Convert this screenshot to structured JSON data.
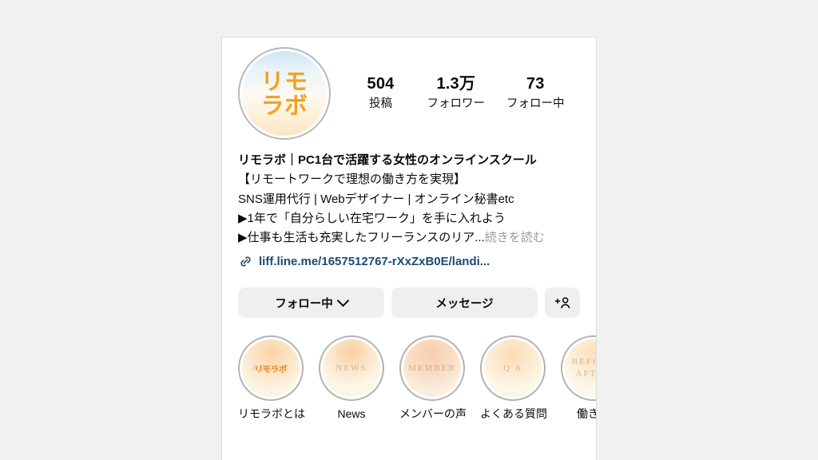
{
  "page": {
    "background_color": "#f1f1f1",
    "card_background": "#ffffff"
  },
  "profile": {
    "avatar": {
      "logo_line1": "リモ",
      "logo_line2": "ラボ",
      "logo_color": "#f5a020",
      "ring_color": "#b8b8b8"
    },
    "stats": [
      {
        "value": "504",
        "label": "投稿"
      },
      {
        "value": "1.3万",
        "label": "フォロワー"
      },
      {
        "value": "73",
        "label": "フォロー中"
      }
    ],
    "bio": {
      "title": "リモラボ｜PC1台で活躍する女性のオンラインスクール",
      "lines": [
        "【リモートワークで理想の働き方を実現】",
        "SNS運用代行 | Webデザイナー | オンライン秘書etc",
        "▶1年で「自分らしい在宅ワーク」を手に入れよう"
      ],
      "truncated_line": "▶仕事も生活も充実したフリーランスのリア...",
      "more_label": "続きを読む",
      "link_text": "liff.line.me/1657512767-rXxZxB0E/landi...",
      "link_color": "#1c4a78"
    },
    "actions": {
      "following_label": "フォロー中",
      "message_label": "メッセージ",
      "add_user_label": "",
      "button_background": "#efefef"
    },
    "highlights": [
      {
        "label": "リモラボとは",
        "cover_text": "ABOUT",
        "badge": "リモラボ"
      },
      {
        "label": "News",
        "cover_text": "NEWS",
        "badge": ""
      },
      {
        "label": "メンバーの声",
        "cover_text": "MEMBER",
        "badge": ""
      },
      {
        "label": "よくある質問",
        "cover_text": "Q   A",
        "badge": ""
      },
      {
        "label": "働き方",
        "cover_text": "BEFORE\nAFTER",
        "badge": ""
      }
    ]
  }
}
